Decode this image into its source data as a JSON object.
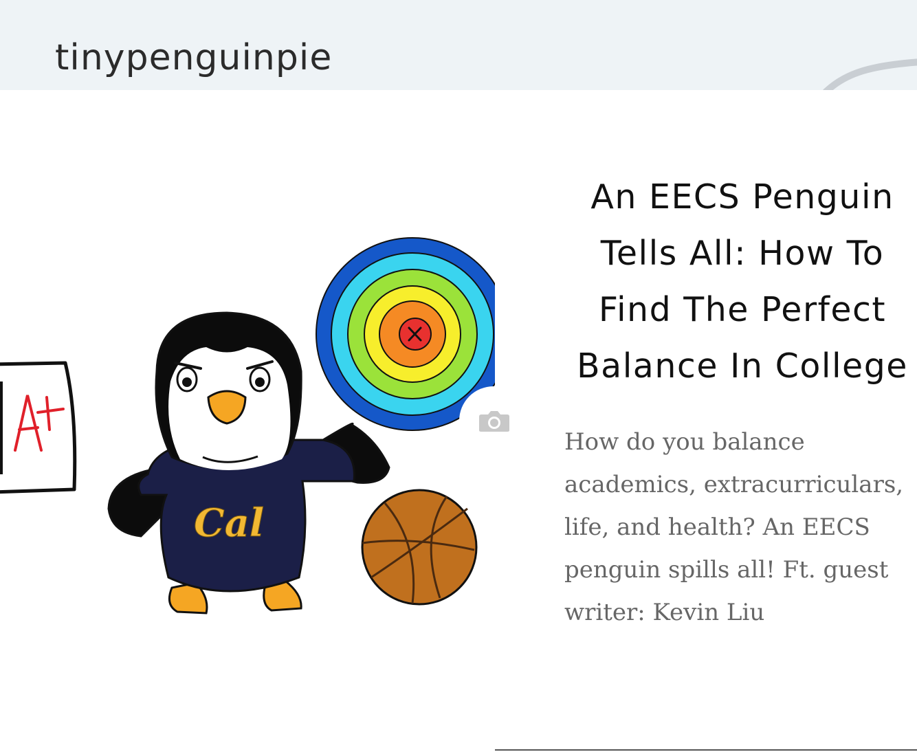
{
  "header": {
    "site_title": "tinypenguinpie"
  },
  "post": {
    "title": "An EECS Penguin Tells All: How To Find The Perfect Balance In College",
    "excerpt": "How do you balance academics, extracurriculars, life, and health? An EECS penguin spills all! Ft. guest writer: Kevin Liu"
  },
  "illustration": {
    "paper_grade": "A+",
    "sweater_text": "Cal",
    "target_center_mark": "x"
  },
  "icons": {
    "camera": "camera-icon"
  },
  "colors": {
    "header_bg": "#eef3f6",
    "title_text": "#111111",
    "excerpt_text": "#666666",
    "sweater_navy": "#1b1f47",
    "cal_gold": "#f2b833",
    "basketball": "#c0701e"
  }
}
